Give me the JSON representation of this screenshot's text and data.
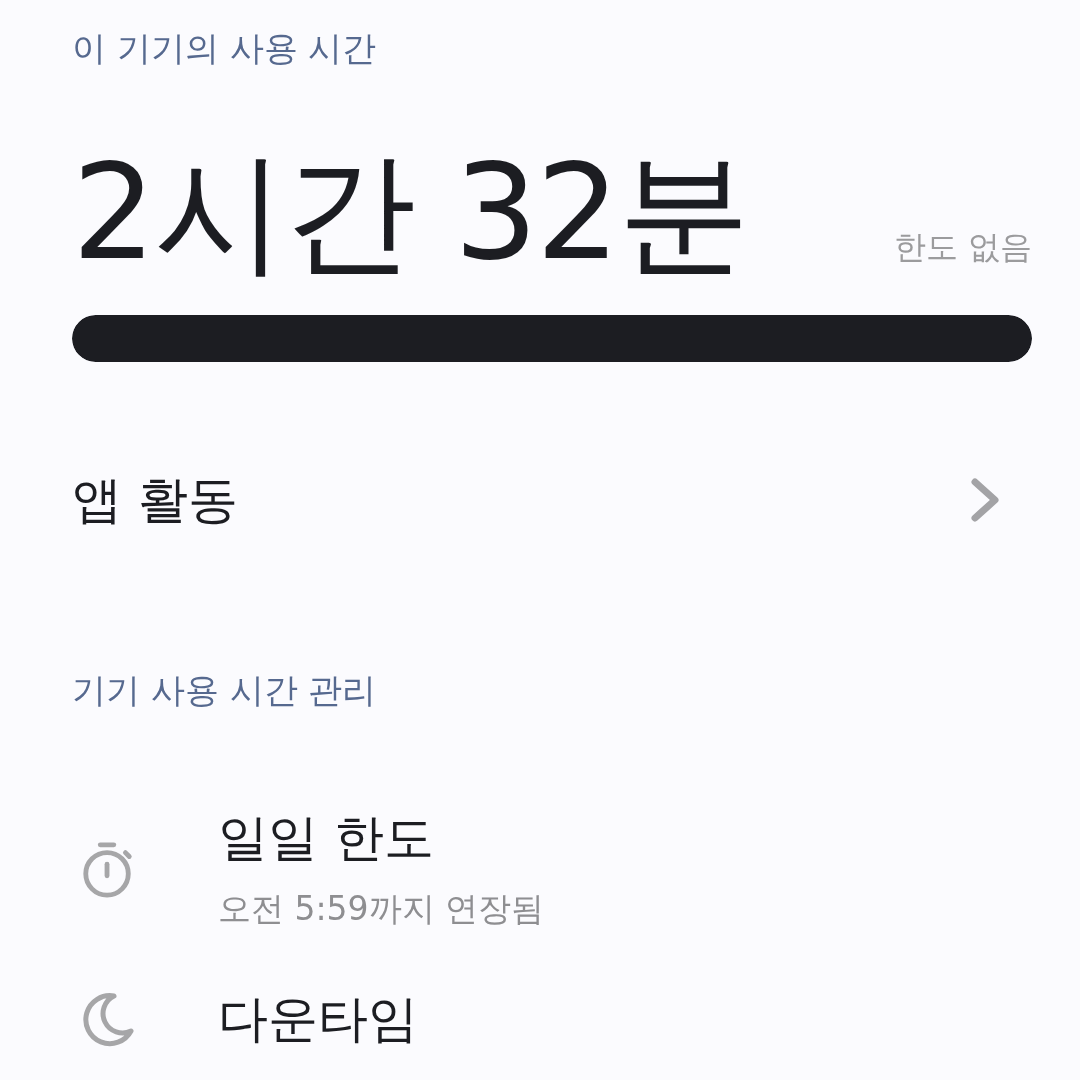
{
  "usage": {
    "label": "이 기기의 사용 시간",
    "total": "2시간 32분",
    "limit": "한도 없음",
    "level": 1
  },
  "app_activity": {
    "label": "앱 활동"
  },
  "management": {
    "heading": "기기 사용 시간 관리",
    "items": [
      {
        "kind": "timer",
        "title": "일일 한도",
        "subtitle": "오전 5:59까지 연장됨"
      },
      {
        "kind": "downtime",
        "title": "다운타임"
      }
    ]
  }
}
